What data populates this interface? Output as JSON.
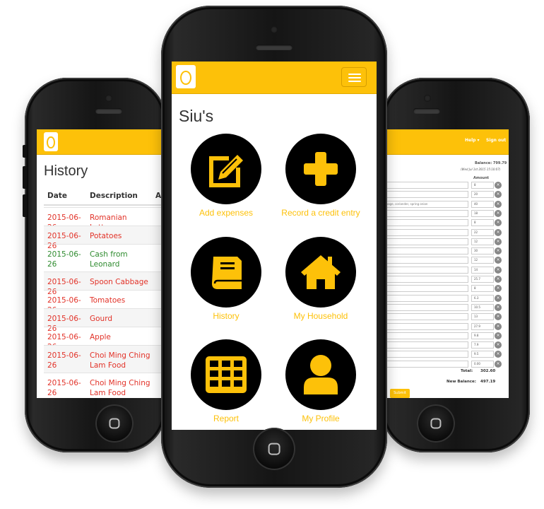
{
  "colors": {
    "accent": "#fdc109",
    "expense": "#e23228",
    "credit": "#2e8b2e",
    "text": "#333333"
  },
  "history": {
    "title": "History",
    "columns": [
      "Date",
      "Description",
      "A"
    ],
    "rows": [
      {
        "date": "2015-06-26",
        "description": "Romanian Lettuce",
        "type": "expense"
      },
      {
        "date": "2015-06-26",
        "description": "Potatoes",
        "type": "expense"
      },
      {
        "date": "2015-06-26",
        "description": "Cash from Leonard",
        "type": "credit"
      },
      {
        "date": "2015-06-26",
        "description": "Spoon Cabbage",
        "type": "expense"
      },
      {
        "date": "2015-06-26",
        "description": "Tomatoes",
        "type": "expense"
      },
      {
        "date": "2015-06-26",
        "description": "Gourd",
        "type": "expense"
      },
      {
        "date": "2015-06-26",
        "description": "Apple",
        "type": "expense"
      },
      {
        "date": "2015-06-26",
        "description": "Choi Ming Ching Lam Food",
        "type": "expense"
      },
      {
        "date": "2015-06-26",
        "description": "Choi Ming Ching Lam Food",
        "type": "expense"
      }
    ]
  },
  "main": {
    "household_name": "Siu's",
    "menu_icon": "hamburger-icon",
    "tiles": [
      {
        "label": "Add expenses",
        "icon": "edit-icon"
      },
      {
        "label": "Record a credit entry",
        "icon": "plus-icon"
      },
      {
        "label": "History",
        "icon": "book-icon"
      },
      {
        "label": "My Household",
        "icon": "home-icon"
      },
      {
        "label": "Report",
        "icon": "table-icon"
      },
      {
        "label": "My Profile",
        "icon": "user-icon"
      }
    ]
  },
  "expense_form": {
    "nav": {
      "help": "Help ▾",
      "signout": "Sign out"
    },
    "balance_label": "Balance: 799.79",
    "balance_date": "(Wed Jul 1st 2015 15:10:07)",
    "amount_header": "Amount",
    "items": [
      {
        "desc": "",
        "amount": "8"
      },
      {
        "desc": "",
        "amount": "20"
      },
      {
        "desc": "bbage, coriander, spring onion",
        "amount": "40"
      },
      {
        "desc": "",
        "amount": "18"
      },
      {
        "desc": "",
        "amount": "8"
      },
      {
        "desc": "",
        "amount": "22"
      },
      {
        "desc": "",
        "amount": "12"
      },
      {
        "desc": "",
        "amount": "30"
      },
      {
        "desc": "",
        "amount": "12"
      },
      {
        "desc": "",
        "amount": "14"
      },
      {
        "desc": "",
        "amount": "25.7"
      },
      {
        "desc": "",
        "amount": "8"
      },
      {
        "desc": "",
        "amount": "6.3"
      },
      {
        "desc": "",
        "amount": "10.5"
      },
      {
        "desc": "",
        "amount": "13"
      },
      {
        "desc": "",
        "amount": "27.9"
      },
      {
        "desc": "",
        "amount": "9.8"
      },
      {
        "desc": "",
        "amount": "7.9"
      },
      {
        "desc": "",
        "amount": "9.5"
      },
      {
        "desc": "",
        "amount": "0.00"
      }
    ],
    "total_label": "Total:",
    "total_value": "302.60",
    "new_balance_label": "New Balance:",
    "new_balance_value": "497.19",
    "submit": "Submit"
  }
}
